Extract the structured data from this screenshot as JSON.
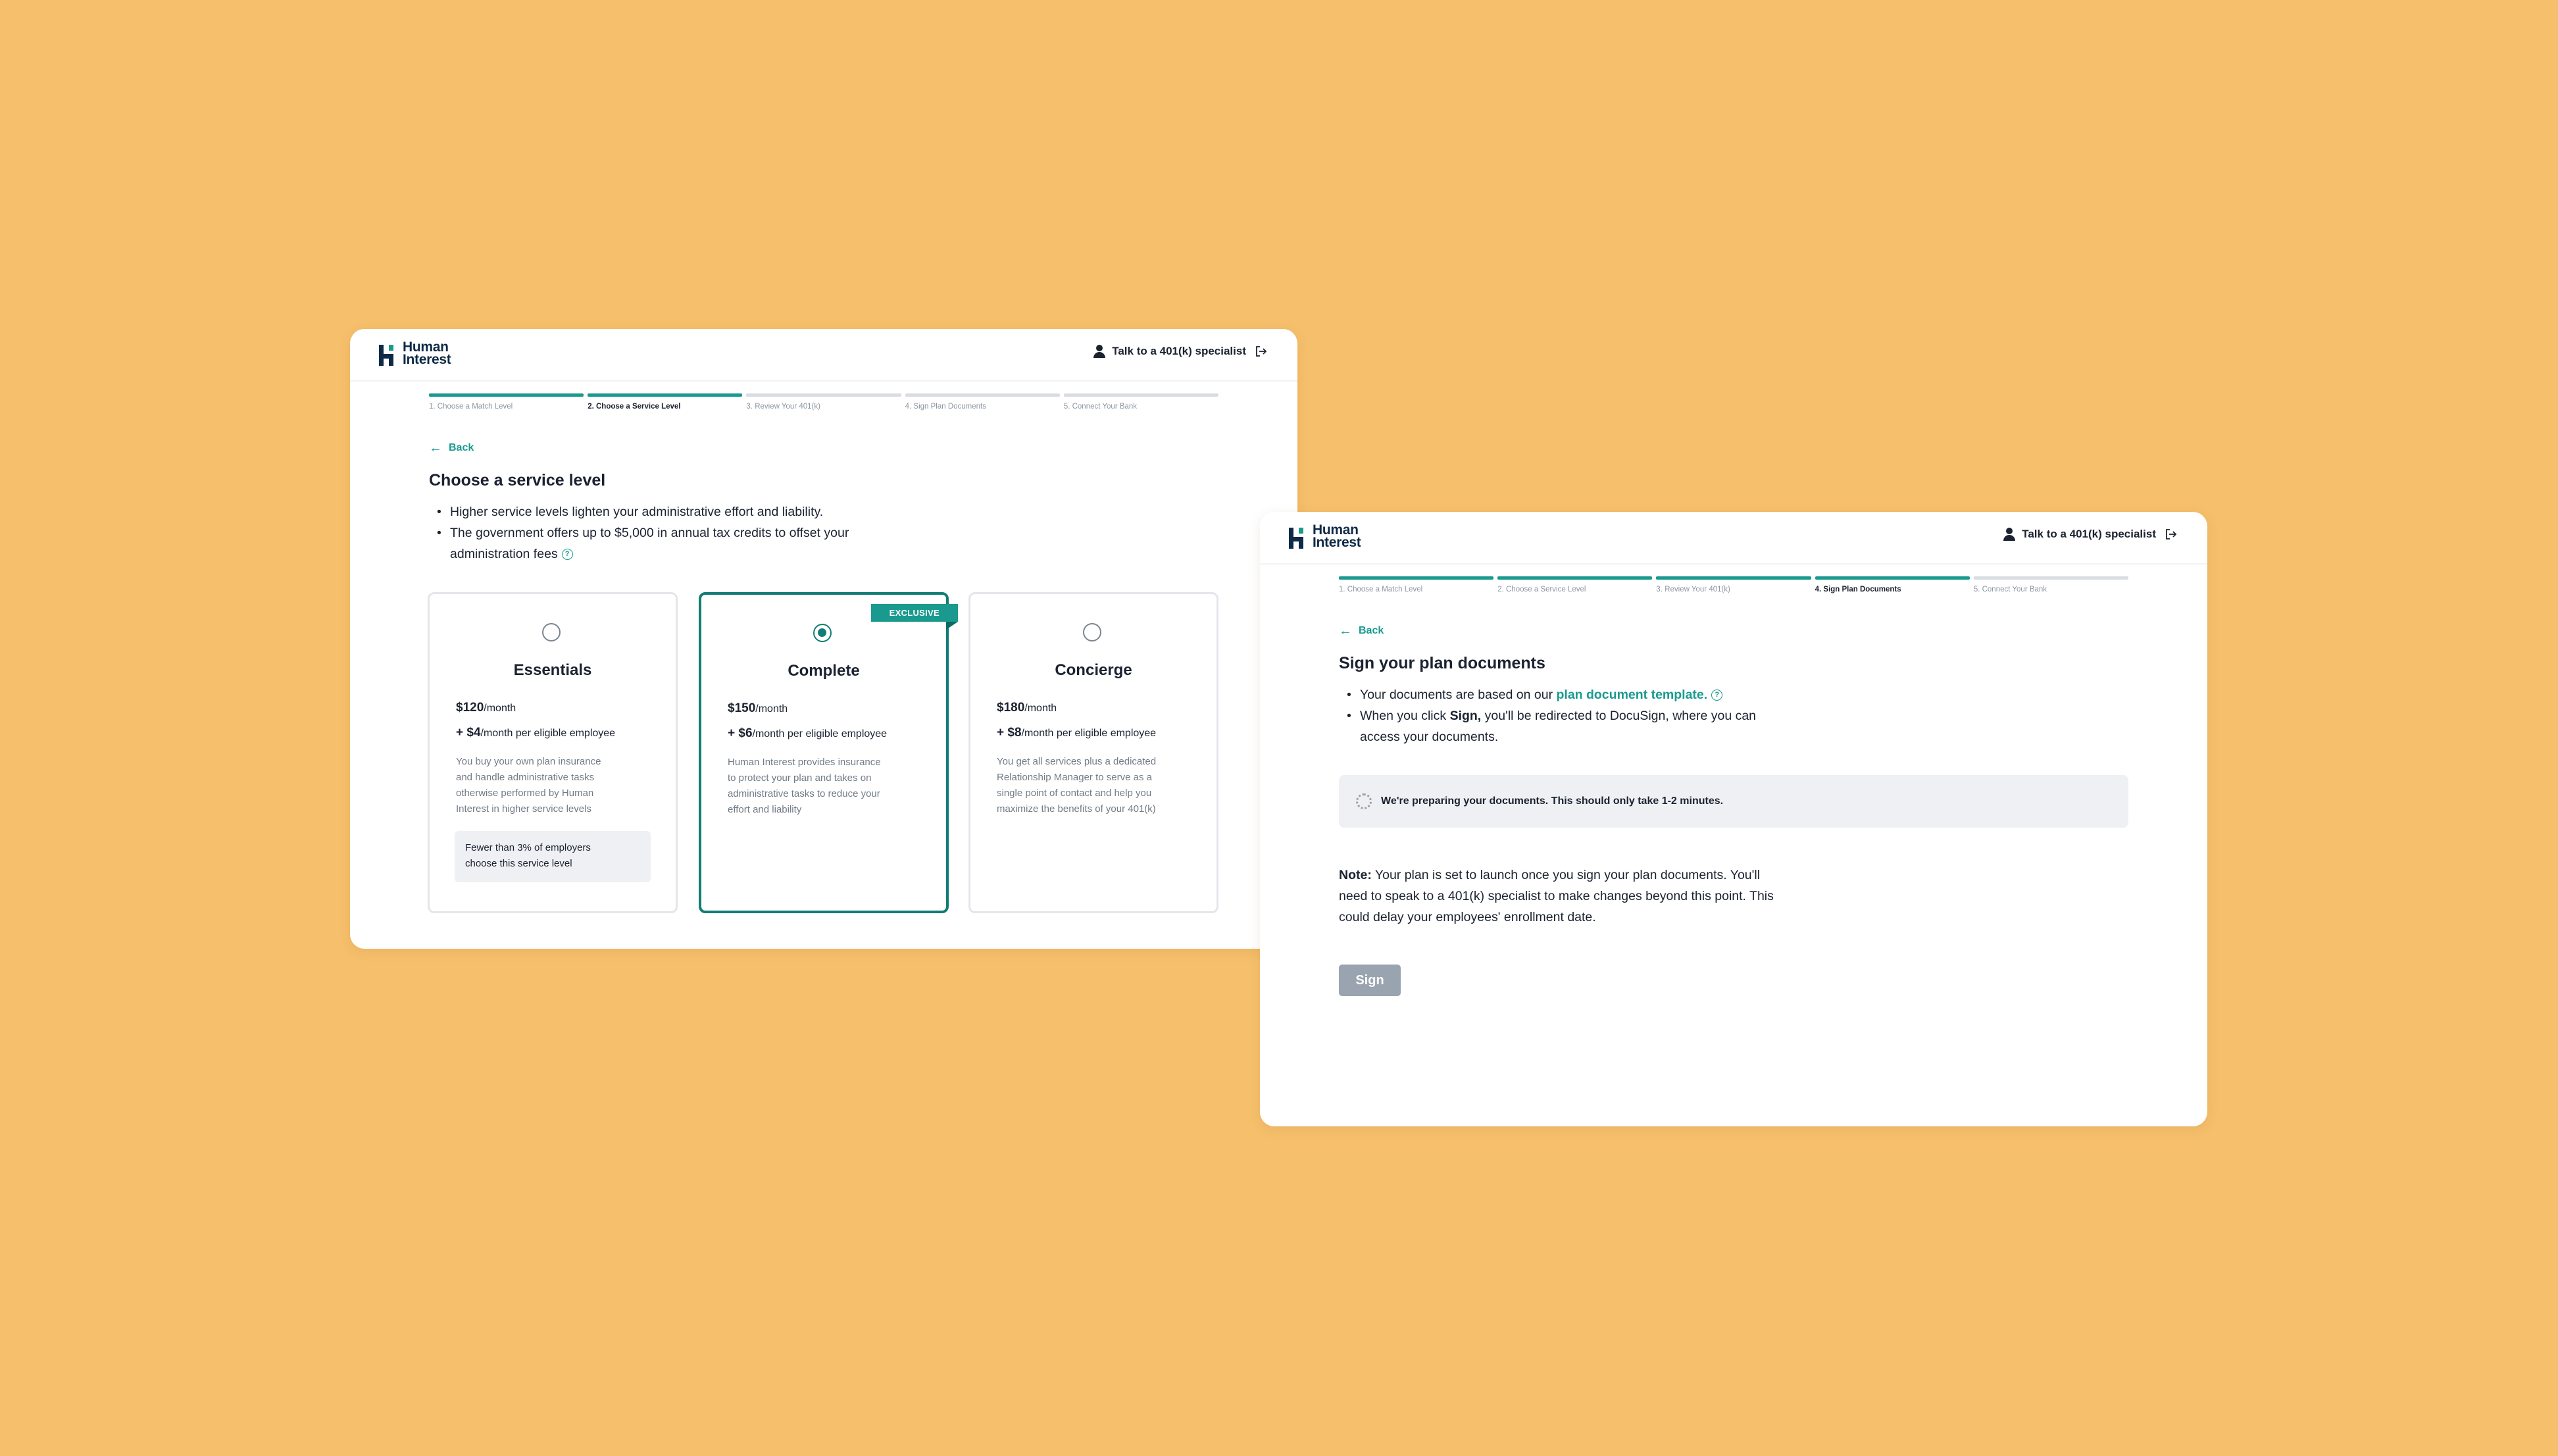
{
  "brand": {
    "line1": "Human",
    "line2": "Interest"
  },
  "header": {
    "talk_label": "Talk to a 401(k) specialist"
  },
  "steps": [
    "1. Choose a Match Level",
    "2. Choose a Service Level",
    "3. Review Your 401(k)",
    "4. Sign Plan Documents",
    "5. Connect Your Bank"
  ],
  "back_label": "Back",
  "service_page": {
    "current_step": 2,
    "title": "Choose a service level",
    "bullets": [
      "Higher service levels lighten your administrative effort and liability.",
      "The government offers up to $5,000 in annual tax credits to offset your",
      "administration fees"
    ],
    "plans": [
      {
        "name": "Essentials",
        "price": "$120",
        "price_unit": "/month",
        "per_employee_prefix": "+ ",
        "per_employee_price": "$4",
        "per_employee_suffix": "/month per eligible employee",
        "desc_lines": [
          "You buy your own plan insurance",
          "and handle administrative tasks",
          "otherwise performed by Human",
          "Interest in higher service levels"
        ],
        "note_lines": [
          "Fewer than 3% of employers",
          "choose this service level"
        ],
        "selected": false
      },
      {
        "name": "Complete",
        "price": "$150",
        "price_unit": "/month",
        "per_employee_prefix": "+ ",
        "per_employee_price": "$6",
        "per_employee_suffix": "/month per eligible employee",
        "desc_lines": [
          "Human Interest provides insurance",
          "to protect your plan and takes on",
          "administrative tasks to reduce your",
          "effort and liability"
        ],
        "badge": "EXCLUSIVE",
        "selected": true
      },
      {
        "name": "Concierge",
        "price": "$180",
        "price_unit": "/month",
        "per_employee_prefix": "+ ",
        "per_employee_price": "$8",
        "per_employee_suffix": "/month per eligible employee",
        "desc_lines": [
          "You get all services plus a dedicated",
          "Relationship Manager to serve as a",
          "single point of contact and help you",
          "maximize the benefits of your 401(k)"
        ],
        "selected": false
      }
    ]
  },
  "sign_page": {
    "current_step": 4,
    "title": "Sign your plan documents",
    "bullet1_prefix": "Your documents are based on our ",
    "bullet1_link": "plan document template.",
    "bullet2_prefix": "When you click ",
    "bullet2_bold": "Sign,",
    "bullet2_line1_rest": " you'll be redirected to DocuSign, where you can",
    "bullet2_line2": "access your documents.",
    "loading_text": "We're preparing your documents. This should only take 1-2 minutes.",
    "note_label": "Note:",
    "note_lines": [
      " Your plan is set to launch once you sign your plan documents. You'll",
      "need to speak to a 401(k) specialist to make changes beyond this point. This",
      "could delay your employees' enrollment date."
    ],
    "sign_label": "Sign"
  },
  "colors": {
    "background": "#F6BF6B",
    "accent": "#1a9a8f",
    "accent_dark": "#117d74",
    "navy": "#0e2a47",
    "disabled": "#9aa4b0"
  }
}
